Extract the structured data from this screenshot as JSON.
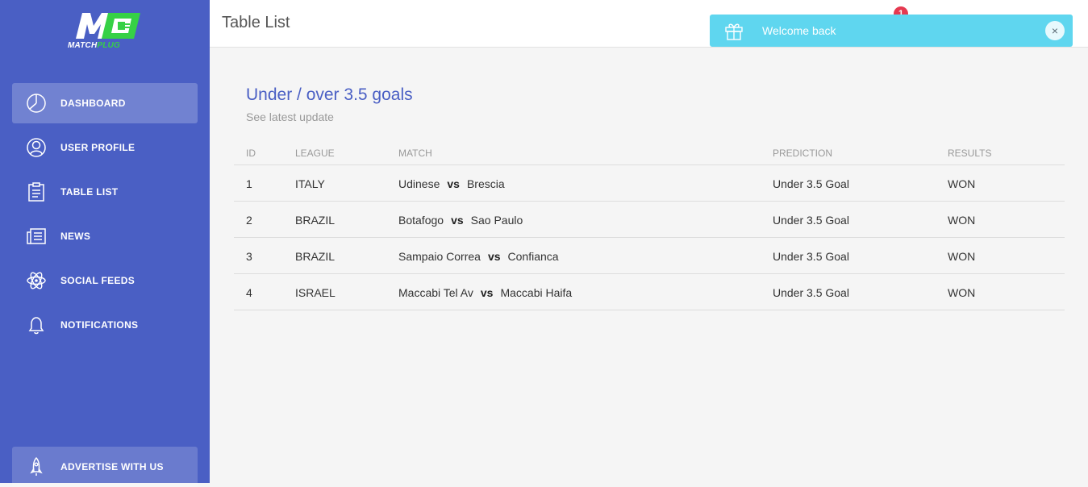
{
  "brand": {
    "logo_text_a": "MATCH",
    "logo_text_b": "PLUG",
    "accent": "#36d146"
  },
  "sidebar": {
    "items": [
      {
        "label": "DASHBOARD",
        "icon": "pie-chart-icon",
        "active": true
      },
      {
        "label": "USER PROFILE",
        "icon": "user-icon",
        "active": false
      },
      {
        "label": "TABLE LIST",
        "icon": "clipboard-icon",
        "active": false
      },
      {
        "label": "NEWS",
        "icon": "newspaper-icon",
        "active": false
      },
      {
        "label": "SOCIAL FEEDS",
        "icon": "atom-icon",
        "active": false
      },
      {
        "label": "NOTIFICATIONS",
        "icon": "bell-icon",
        "active": false
      }
    ],
    "advertise": {
      "label": "ADVERTISE WITH US",
      "icon": "rocket-icon"
    }
  },
  "header": {
    "title": "Table List",
    "notification_count": "1"
  },
  "toast": {
    "message": "Welcome back",
    "close": "×",
    "icon": "gift-icon"
  },
  "card": {
    "title": "Under / over 3.5 goals",
    "subtitle": "See latest update"
  },
  "table": {
    "headers": [
      "ID",
      "LEAGUE",
      "MATCH",
      "PREDICTION",
      "RESULTS"
    ],
    "vs": "vs",
    "rows": [
      {
        "id": "1",
        "league": "ITALY",
        "home": "Udinese",
        "away": "Brescia",
        "prediction": "Under 3.5 Goal",
        "result": "WON"
      },
      {
        "id": "2",
        "league": "BRAZIL",
        "home": "Botafogo",
        "away": "Sao Paulo",
        "prediction": "Under 3.5 Goal",
        "result": "WON"
      },
      {
        "id": "3",
        "league": "BRAZIL",
        "home": "Sampaio Correa",
        "away": "Confianca",
        "prediction": "Under 3.5 Goal",
        "result": "WON"
      },
      {
        "id": "4",
        "league": "ISRAEL",
        "home": "Maccabi Tel Av",
        "away": "Maccabi Haifa",
        "prediction": "Under 3.5 Goal",
        "result": "WON"
      }
    ]
  },
  "colors": {
    "sidebar": "#4a5fc4",
    "title": "#4a5fc4",
    "toast": "#5fd6ef",
    "badge": "#e53950"
  }
}
